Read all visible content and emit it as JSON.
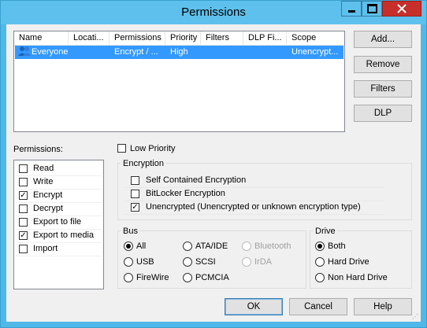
{
  "window": {
    "title": "Permissions"
  },
  "list": {
    "columns": [
      "Name",
      "Locati...",
      "Permissions",
      "Priority",
      "Filters",
      "DLP Fi...",
      "Scope"
    ],
    "rows": [
      {
        "name": "Everyone",
        "location": "",
        "permissions": "Encrypt / ...",
        "priority": "High",
        "filters": "",
        "dlp": "",
        "scope": "Unencrypt..."
      }
    ]
  },
  "side_buttons": {
    "add": "Add...",
    "remove": "Remove",
    "filters": "Filters",
    "dlp": "DLP"
  },
  "permissions": {
    "label": "Permissions:",
    "items": [
      {
        "label": "Read",
        "checked": false
      },
      {
        "label": "Write",
        "checked": false
      },
      {
        "label": "Encrypt",
        "checked": true
      },
      {
        "label": "Decrypt",
        "checked": false
      },
      {
        "label": "Export to file",
        "checked": false
      },
      {
        "label": "Export to media",
        "checked": true
      },
      {
        "label": "Import",
        "checked": false
      }
    ]
  },
  "low_priority": {
    "label": "Low Priority",
    "checked": false
  },
  "encryption": {
    "title": "Encryption",
    "items": [
      {
        "label": "Self Contained Encryption",
        "checked": false
      },
      {
        "label": "BitLocker Encryption",
        "checked": false
      },
      {
        "label": "Unencrypted (Unencrypted or unknown encryption type)",
        "checked": true
      }
    ]
  },
  "bus": {
    "title": "Bus",
    "options": [
      {
        "label": "All",
        "selected": true,
        "enabled": true
      },
      {
        "label": "ATA/IDE",
        "selected": false,
        "enabled": true
      },
      {
        "label": "Bluetooth",
        "selected": false,
        "enabled": false
      },
      {
        "label": "USB",
        "selected": false,
        "enabled": true
      },
      {
        "label": "SCSI",
        "selected": false,
        "enabled": true
      },
      {
        "label": "IrDA",
        "selected": false,
        "enabled": false
      },
      {
        "label": "FireWire",
        "selected": false,
        "enabled": true
      },
      {
        "label": "PCMCIA",
        "selected": false,
        "enabled": true
      }
    ]
  },
  "drive": {
    "title": "Drive",
    "options": [
      {
        "label": "Both",
        "selected": true
      },
      {
        "label": "Hard Drive",
        "selected": false
      },
      {
        "label": "Non Hard Drive",
        "selected": false
      }
    ]
  },
  "footer": {
    "ok": "OK",
    "cancel": "Cancel",
    "help": "Help"
  },
  "colors": {
    "titlebar": "#5ec0ec",
    "selection": "#3399ff",
    "close": "#c7302a"
  },
  "icons": {
    "user": "group-user-icon",
    "minimize": "minimize-icon",
    "maximize": "maximize-icon",
    "close": "close-icon"
  }
}
